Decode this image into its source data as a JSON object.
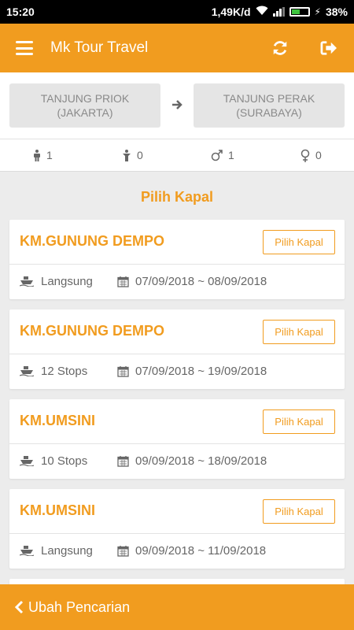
{
  "status_bar": {
    "time": "15:20",
    "speed": "1,49K/d",
    "battery": "38%"
  },
  "app_bar": {
    "title": "Mk Tour Travel",
    "icons": [
      "menu-icon",
      "refresh-icon",
      "logout-icon"
    ]
  },
  "route": {
    "origin_line1": "TANJUNG PRIOK",
    "origin_line2": "(JAKARTA)",
    "destination_line1": "TANJUNG PERAK",
    "destination_line2": "(SURABAYA)"
  },
  "passengers": {
    "adult": "1",
    "child": "0",
    "male": "1",
    "female": "0"
  },
  "section_title": "Pilih Kapal",
  "ships": [
    {
      "name": "KM.GUNUNG DEMPO",
      "button": "Pilih Kapal",
      "stops": "Langsung",
      "dates": "07/09/2018 ~ 08/09/2018"
    },
    {
      "name": "KM.GUNUNG DEMPO",
      "button": "Pilih Kapal",
      "stops": "12 Stops",
      "dates": "07/09/2018 ~ 19/09/2018"
    },
    {
      "name": "KM.UMSINI",
      "button": "Pilih Kapal",
      "stops": "10 Stops",
      "dates": "09/09/2018 ~ 18/09/2018"
    },
    {
      "name": "KM.UMSINI",
      "button": "Pilih Kapal",
      "stops": "Langsung",
      "dates": "09/09/2018 ~ 11/09/2018"
    }
  ],
  "bottom_button": "Ubah Pencarian",
  "colors": {
    "accent": "#f19c1f",
    "background": "#ececec",
    "card": "#ffffff",
    "text_muted": "#666666"
  }
}
